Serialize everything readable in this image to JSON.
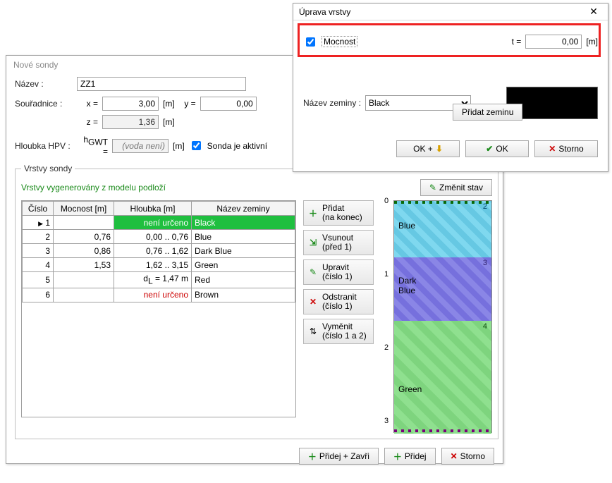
{
  "back_win": {
    "title": "Nové sondy",
    "name_label": "Název :",
    "name_value": "ZZ1",
    "coord_label": "Souřadnice :",
    "x_label": "x =",
    "x_value": "3,00",
    "x_unit": "[m]",
    "y_label": "y =",
    "y_value": "0,00",
    "z_label": "z =",
    "z_value": "1,36",
    "z_unit": "[m]",
    "hpv_label": "Hloubka HPV :",
    "hgwt_label": "hGWT =",
    "hgwt_placeholder": "(voda není)",
    "hgwt_unit": "[m]",
    "active_label": "Sonda je aktivní",
    "layers_legend": "Vrstvy sondy",
    "gen_text": "Vrstvy vygenerovány z modelu podloží",
    "change_state": "Změnit stav",
    "cols": {
      "num": "Číslo",
      "thick": "Mocnost [m]",
      "depth": "Hloubka [m]",
      "soil": "Název zeminy"
    },
    "rows": [
      {
        "num": "1",
        "thick": "",
        "depth": "není určeno",
        "soil": "Black",
        "sel": true
      },
      {
        "num": "2",
        "thick": "0,76",
        "depth": "0,00 .. 0,76",
        "soil": "Blue"
      },
      {
        "num": "3",
        "thick": "0,86",
        "depth": "0,76 .. 1,62",
        "soil": "Dark Blue"
      },
      {
        "num": "4",
        "thick": "1,53",
        "depth": "1,62 .. 3,15",
        "soil": "Green"
      },
      {
        "num": "5",
        "thick": "",
        "depth": "dL = 1,47 m",
        "soil": "Red",
        "depth_dl": true
      },
      {
        "num": "6",
        "thick": "",
        "depth": "není určeno",
        "soil": "Brown",
        "depth_red": true
      }
    ],
    "sidebtns": {
      "add": {
        "l1": "Přidat",
        "l2": "(na konec)"
      },
      "insert": {
        "l1": "Vsunout",
        "l2": "(před 1)"
      },
      "edit": {
        "l1": "Upravit",
        "l2": "(číslo 1)"
      },
      "remove": {
        "l1": "Odstranit",
        "l2": "(číslo 1)"
      },
      "swap": {
        "l1": "Vyměnit",
        "l2": "(číslo 1 a 2)"
      }
    },
    "soil_labels": {
      "blue": "Blue",
      "darkblue": "Dark\nBlue",
      "green": "Green"
    },
    "axis_ticks": [
      "0",
      "1",
      "2",
      "3"
    ],
    "bottom": {
      "add_close": "Přidej + Zavři",
      "add": "Přidej",
      "cancel": "Storno"
    }
  },
  "dlg": {
    "title": "Úprava vrstvy",
    "thickness_label": "Mocnost",
    "t_label": "t =",
    "t_value": "0,00",
    "t_unit": "[m]",
    "soil_label": "Název zeminy :",
    "soil_value": "Black",
    "add_soil": "Přidat zeminu",
    "ok_plus": "OK +",
    "ok": "OK",
    "cancel": "Storno"
  }
}
